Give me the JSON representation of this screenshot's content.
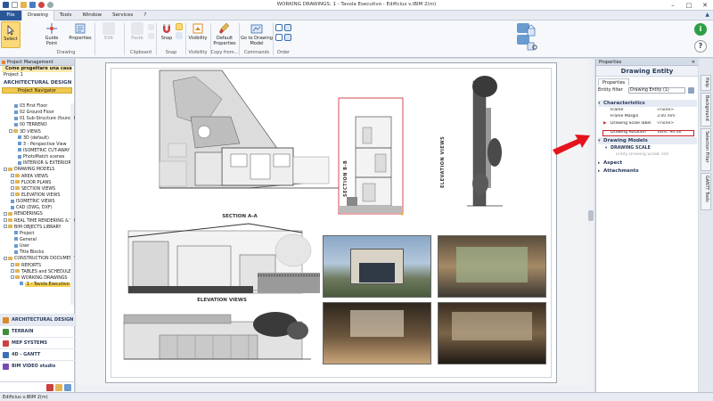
{
  "window": {
    "title": "WORKING DRAWINGS: 1 - Tavola Esecutivo - Edificius v.iBIM 2(m)"
  },
  "ribbon_tabs": [
    "File",
    "Drawing",
    "Tools",
    "Window",
    "Services"
  ],
  "active_tab": "Drawing",
  "help_label": "?",
  "ribbon": {
    "select": "Select",
    "guide_point": "Guide Point",
    "properties": "Properties",
    "edit": "Edit",
    "paste": "Paste",
    "snap": "Snap",
    "visibility": "Visibility",
    "default_properties": "Default Properties",
    "go_to_drawing_model": "Go to Drawing Model",
    "groups": {
      "drawing": "Drawing",
      "clipboard": "Clipboard",
      "snap": "Snap",
      "visibility": "Visibility",
      "copy_from": "Copy from...",
      "commands": "Commands",
      "order": "Order"
    }
  },
  "left_panel": {
    "header": "Project Management",
    "project_name": "Come progettare una casa",
    "project_item": "Project 1",
    "section_title": "ARCHITECTURAL DESIGN",
    "navigator": "Project Navigator",
    "tree": [
      {
        "label": "03 First Floor",
        "indent": 16,
        "type": "doc"
      },
      {
        "label": "02 Ground Floor",
        "indent": 16,
        "type": "doc"
      },
      {
        "label": "01 Sub-Structure (foundation)",
        "indent": 16,
        "type": "doc"
      },
      {
        "label": "00 TERRENO",
        "indent": 16,
        "type": "doc"
      },
      {
        "label": "3D VIEWS",
        "indent": 10,
        "type": "folder"
      },
      {
        "label": "3D (default)",
        "indent": 20,
        "type": "doc"
      },
      {
        "label": "3 - Perspective View",
        "indent": 20,
        "type": "doc"
      },
      {
        "label": "ISOMETRIC CUT-AWAY",
        "indent": 20,
        "type": "doc"
      },
      {
        "label": "PhotoMatch scenes",
        "indent": 20,
        "type": "doc"
      },
      {
        "label": "INTERIOR & EXTERIOR",
        "indent": 20,
        "type": "doc"
      },
      {
        "label": "DRAWING MODELS",
        "indent": 4,
        "type": "folder"
      },
      {
        "label": "AREA VIEWS",
        "indent": 12,
        "type": "folder"
      },
      {
        "label": "FLOOR PLANS",
        "indent": 12,
        "type": "folder"
      },
      {
        "label": "SECTION VIEWS",
        "indent": 12,
        "type": "folder"
      },
      {
        "label": "ELEVATION VIEWS",
        "indent": 12,
        "type": "folder"
      },
      {
        "label": "ISOMETRIC VIEWS",
        "indent": 12,
        "type": "doc"
      },
      {
        "label": "CAD (DWG, DXF)",
        "indent": 12,
        "type": "doc"
      },
      {
        "label": "RENDERINGS",
        "indent": 4,
        "type": "folder"
      },
      {
        "label": "REAL TIME RENDERING & VR",
        "indent": 4,
        "type": "folder"
      },
      {
        "label": "BIM OBJECTS LIBRARY",
        "indent": 4,
        "type": "folder"
      },
      {
        "label": "Project",
        "indent": 16,
        "type": "doc"
      },
      {
        "label": "General",
        "indent": 16,
        "type": "doc"
      },
      {
        "label": "User",
        "indent": 16,
        "type": "doc"
      },
      {
        "label": "Title Blocks",
        "indent": 16,
        "type": "doc"
      },
      {
        "label": "CONSTRUCTION DOCUMENTS",
        "indent": 4,
        "type": "folder"
      },
      {
        "label": "REPORTS",
        "indent": 12,
        "type": "folder"
      },
      {
        "label": "TABLES and SCHEDULES",
        "indent": 12,
        "type": "folder"
      },
      {
        "label": "WORKING DRAWINGS",
        "indent": 12,
        "type": "folder"
      },
      {
        "label": "1 - Tavola Esecutivo",
        "indent": 22,
        "type": "doc",
        "selected": true
      }
    ],
    "modules": [
      {
        "label": "ARCHITECTURAL DESIGN",
        "color": "#d9892e"
      },
      {
        "label": "TERRAIN",
        "color": "#3f8f3a"
      },
      {
        "label": "MEP SYSTEMS",
        "color": "#d04040"
      },
      {
        "label": "4D - GANTT",
        "color": "#3a6fb5"
      },
      {
        "label": "BIM VIDEO studio",
        "color": "#7a4bb0"
      }
    ]
  },
  "sheet": {
    "section_aa": "SECTION  A-A",
    "section_bb": "SECTION  B-B",
    "elevation_views_v": "ELEVATION VIEWS",
    "elevation_views": "ELEVATION VIEWS"
  },
  "properties": {
    "header": "Properties",
    "title": "Drawing Entity",
    "subtab": "Properties",
    "entity_filter_label": "Entity filter",
    "entity_filter_value": "Drawing Entity (1)",
    "characteristics": "Characteristics",
    "rows": [
      {
        "key": "Frame",
        "value": "<none>"
      },
      {
        "key": "Frame Margin",
        "value": "3.00 mm"
      },
      {
        "key": "Drawing Scale label",
        "value": "<none>"
      },
      {
        "key": "Drawing Rotation",
        "value": "Yaxis: 90.00"
      }
    ],
    "drawing_models": "Drawing Models",
    "drawing_scale": "DRAWING SCALE",
    "entity_drawing_scale_key": "Entity Drawing Scale",
    "entity_drawing_scale_value": "1:100",
    "aspect": "Aspect",
    "attachments": "Attachments"
  },
  "side_tabs": [
    "Help",
    "Background",
    "Selection Filter",
    "GANTT Tools"
  ],
  "status": "Edificius v.iBIM 2(m)"
}
